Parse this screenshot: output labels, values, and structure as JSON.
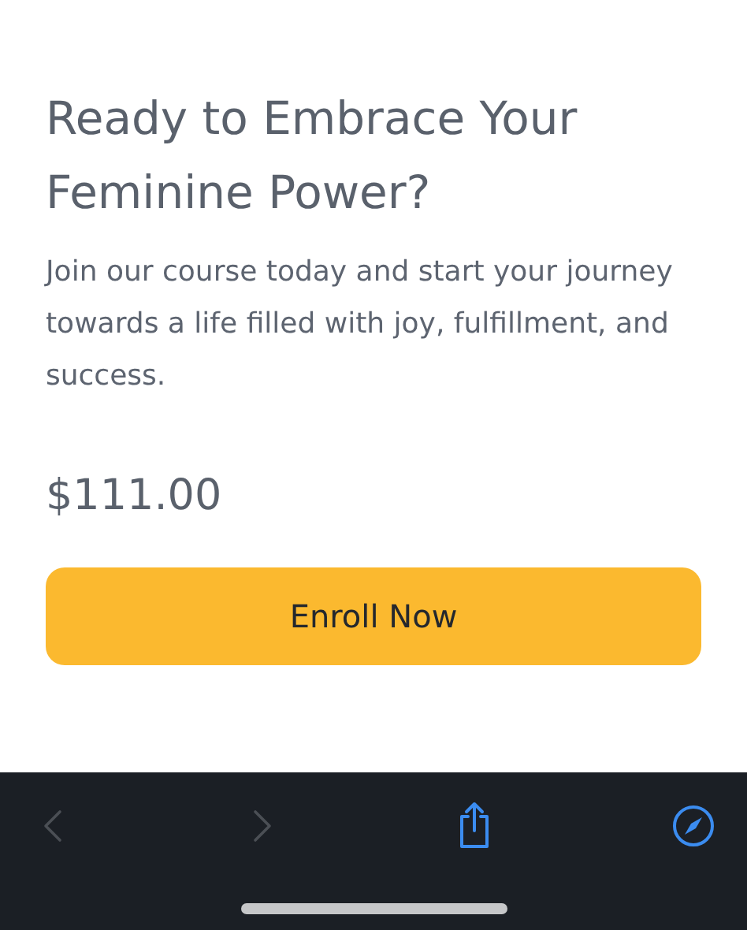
{
  "heading": "Ready to Embrace Your Feminine Power?",
  "description": "Join our course today and start your journey towards a life filled with joy, fulfillment, and success.",
  "price": "$111.00",
  "button": "Enroll Now",
  "toolbar": [
    {
      "kind": "back",
      "disabled": true
    },
    {
      "kind": "forward",
      "disabled": true
    },
    {
      "kind": "share",
      "disabled": false
    },
    {
      "kind": "compass",
      "disabled": false
    }
  ]
}
